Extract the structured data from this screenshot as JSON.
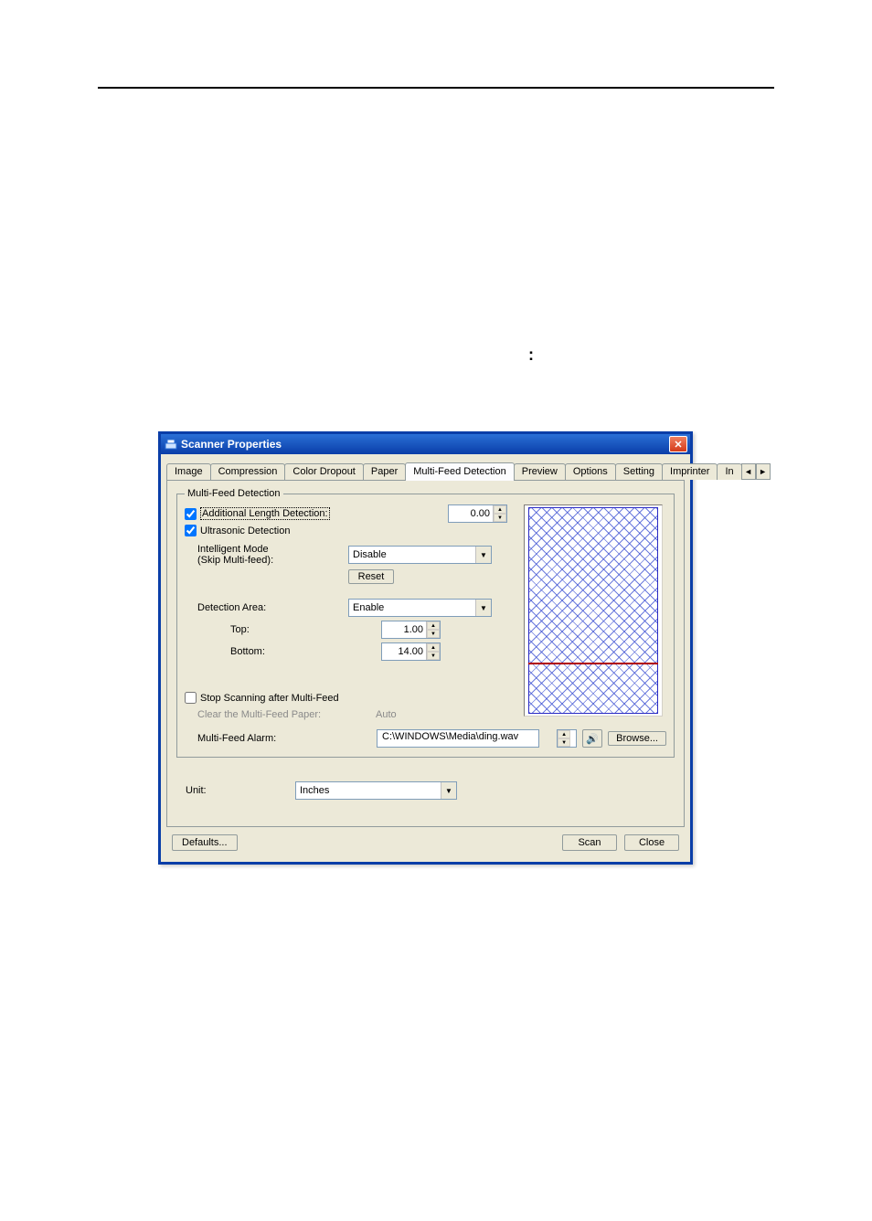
{
  "window": {
    "title": "Scanner Properties"
  },
  "tabs": {
    "items": [
      "Image",
      "Compression",
      "Color Dropout",
      "Paper",
      "Multi-Feed Detection",
      "Preview",
      "Options",
      "Setting",
      "Imprinter",
      "In"
    ],
    "active_index": 4,
    "scroll_left_glyph": "◄",
    "scroll_right_glyph": "►"
  },
  "groupbox": {
    "legend": "Multi-Feed Detection"
  },
  "checks": {
    "additional_length": {
      "label": "Additional Length Detection:",
      "checked": true
    },
    "ultrasonic": {
      "label": "Ultrasonic Detection",
      "checked": true
    },
    "stop_scanning": {
      "label": "Stop Scanning after Multi-Feed",
      "checked": false
    }
  },
  "labels": {
    "intelligent_mode_line1": "Intelligent Mode",
    "intelligent_mode_line2": "(Skip Multi-feed):",
    "detection_area": "Detection Area:",
    "top": "Top:",
    "bottom": "Bottom:",
    "clear_paper": "Clear the Multi-Feed Paper:",
    "clear_paper_value": "Auto",
    "multi_feed_alarm": "Multi-Feed Alarm:",
    "unit": "Unit:"
  },
  "spinners": {
    "additional_length": "0.00",
    "top": "1.00",
    "bottom": "14.00"
  },
  "combos": {
    "intelligent_mode": "Disable",
    "detection_area": "Enable",
    "unit": "Inches"
  },
  "buttons": {
    "reset": "Reset",
    "browse": "Browse...",
    "defaults": "Defaults...",
    "scan": "Scan",
    "close": "Close"
  },
  "alarm_path": "C:\\WINDOWS\\Media\\ding.wav",
  "icons": {
    "speaker": "🔊",
    "close_x": "✕",
    "spin_up": "▲",
    "spin_down": "▼",
    "dropdown": "▼"
  }
}
